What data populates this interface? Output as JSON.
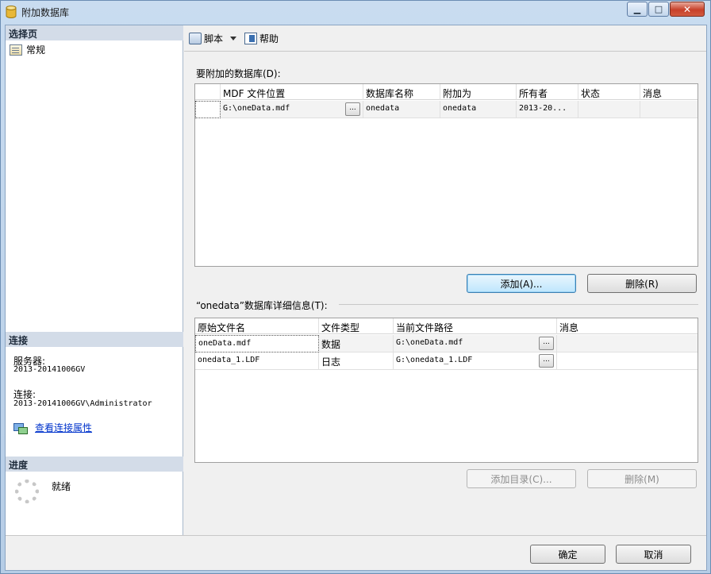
{
  "window": {
    "title": "附加数据库",
    "min_glyph": "▁",
    "max_glyph": "□",
    "close_glyph": "✕"
  },
  "left": {
    "select_page_header": "选择页",
    "pages": [
      {
        "label": "常规"
      }
    ],
    "connection_header": "连接",
    "server_label": "服务器:",
    "server_value": "2013-20141006GV",
    "connection_label": "连接:",
    "connection_value": "2013-20141006GV\\Administrator",
    "view_props_link": "查看连接属性",
    "progress_header": "进度",
    "progress_status": "就绪"
  },
  "toolbar": {
    "script_label": "脚本",
    "help_label": "帮助"
  },
  "attach": {
    "group_label": "要附加的数据库(D):",
    "columns": [
      "MDF 文件位置",
      "数据库名称",
      "附加为",
      "所有者",
      "状态",
      "消息"
    ],
    "rows": [
      {
        "mdf": "G:\\oneData.mdf",
        "browse": "...",
        "dbname": "onedata",
        "attach_as": "onedata",
        "owner": "2013-20...",
        "status": "",
        "message": ""
      }
    ],
    "add_button": "添加(A)...",
    "remove_button": "删除(R)"
  },
  "details": {
    "group_label": "“onedata”数据库详细信息(T):",
    "columns": [
      "原始文件名",
      "文件类型",
      "当前文件路径",
      "消息"
    ],
    "rows": [
      {
        "name": "oneData.mdf",
        "type": "数据",
        "path": "G:\\oneData.mdf",
        "browse": "...",
        "message": ""
      },
      {
        "name": "onedata_1.LDF",
        "type": "日志",
        "path": "G:\\onedata_1.LDF",
        "browse": "...",
        "message": ""
      }
    ],
    "add_catalog_button": "添加目录(C)...",
    "remove_button": "删除(M)"
  },
  "footer": {
    "ok_button": "确定",
    "cancel_button": "取消"
  }
}
